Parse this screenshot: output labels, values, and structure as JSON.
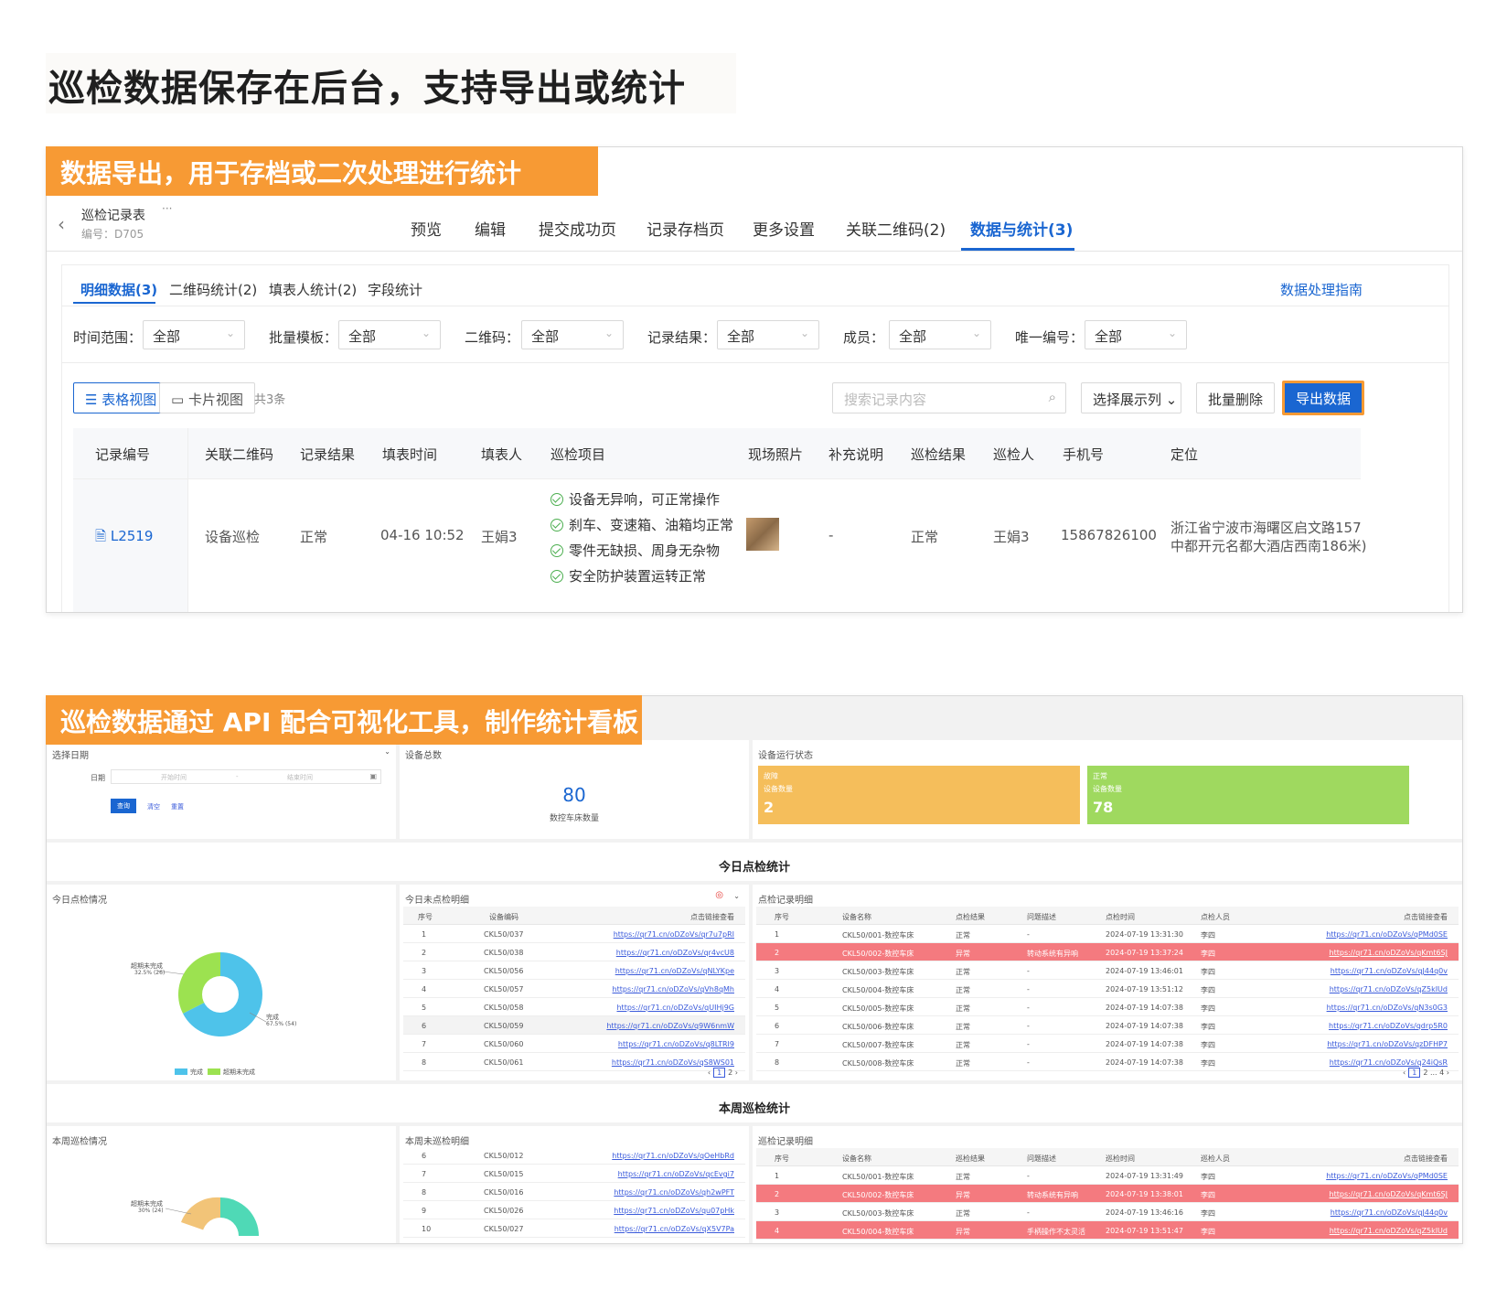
{
  "headline": "巡检数据保存在后台，支持导出或统计",
  "section1": {
    "banner": "数据导出，用于存档或二次处理进行统计",
    "form_title": "巡检记录表",
    "form_more": "···",
    "form_code": "编号：D705",
    "nav_tabs": [
      "预览",
      "编辑",
      "提交成功页",
      "记录存档页",
      "更多设置",
      "关联二维码(2)",
      "数据与统计(3)"
    ],
    "sub_tabs": [
      "明细数据(3)",
      "二维码统计(2)",
      "填表人统计(2)",
      "字段统计"
    ],
    "guide_link": "数据处理指南",
    "filters": [
      {
        "label": "时间范围：",
        "value": "全部"
      },
      {
        "label": "批量模板：",
        "value": "全部"
      },
      {
        "label": "二维码：",
        "value": "全部"
      },
      {
        "label": "记录结果：",
        "value": "全部"
      },
      {
        "label": "成员：",
        "value": "全部"
      },
      {
        "label": "唯一编号：",
        "value": "全部"
      }
    ],
    "view_table": "表格视图",
    "view_card": "卡片视图",
    "total": "共3条",
    "search_placeholder": "搜索记录内容",
    "choose_columns": "选择展示列",
    "batch_delete": "批量删除",
    "export": "导出数据",
    "columns": [
      "记录编号",
      "关联二维码",
      "记录结果",
      "填表时间",
      "填表人",
      "巡检项目",
      "现场照片",
      "补充说明",
      "巡检结果",
      "巡检人",
      "手机号",
      "定位"
    ],
    "row": {
      "id": "L2519",
      "qrcode": "设备巡检",
      "result": "正常",
      "time": "04-16 10:52",
      "filler": "王娟3",
      "items": [
        "设备无异响，可正常操作",
        "刹车、变速箱、油箱均正常",
        "零件无缺损、周身无杂物",
        "安全防护装置运转正常"
      ],
      "note": "-",
      "inspect_result": "正常",
      "inspector": "王娟3",
      "phone": "15867826100",
      "location_l1": "浙江省宁波市海曙区启文路157弄(",
      "location_l2": "中都开元名都大酒店西南186米)"
    },
    "accent": "#1a66d1"
  },
  "section2": {
    "banner": "巡检数据通过 API 配合可视化工具，制作统计看板",
    "date_panel": {
      "title": "选择日期",
      "label": "日期",
      "start": "开始时间",
      "sep": "-",
      "end": "结束时间",
      "query": "查询",
      "clear": "清空",
      "reset": "重置"
    },
    "total_panel": {
      "title": "设备总数",
      "value": "80",
      "caption": "数控车床数量"
    },
    "status_panel": {
      "title": "设备运行状态",
      "fault": {
        "label1": "故障",
        "label2": "设备数量",
        "value": "2",
        "color": "#f5be5b"
      },
      "normal": {
        "label1": "正常",
        "label2": "设备数量",
        "value": "78",
        "color": "#9fd95f"
      }
    },
    "today_title": "今日点检统计",
    "today_pie": {
      "title": "今日点检情况",
      "slices": [
        {
          "name": "完成",
          "label": "完成",
          "pct": "67.5% (54)",
          "value": 54,
          "color": "#4ec3ea"
        },
        {
          "name": "超期未完成",
          "label": "超期未完成",
          "pct": "32.5% (26)",
          "value": 26,
          "color": "#9ce250"
        }
      ],
      "legend": [
        "完成",
        "超期未完成"
      ]
    },
    "today_undone": {
      "title": "今日未点检明细",
      "headers": [
        "序号",
        "设备编码",
        "点击链接查看"
      ],
      "rows": [
        [
          "1",
          "CKL50/037",
          "https://qr71.cn/oDZoVs/qr7u7pRI"
        ],
        [
          "2",
          "CKL50/038",
          "https://qr71.cn/oDZoVs/qr4vcU8"
        ],
        [
          "3",
          "CKL50/056",
          "https://qr71.cn/oDZoVs/qNLYKpe"
        ],
        [
          "4",
          "CKL50/057",
          "https://qr71.cn/oDZoVs/qVh8qMh"
        ],
        [
          "5",
          "CKL50/058",
          "https://qr71.cn/oDZoVs/qUIHj9G"
        ],
        [
          "6",
          "CKL50/059",
          "https://qr71.cn/oDZoVs/q9W6nmW"
        ],
        [
          "7",
          "CKL50/060",
          "https://qr71.cn/oDZoVs/q8LTRI9"
        ],
        [
          "8",
          "CKL50/061",
          "https://qr71.cn/oDZoVs/qS8WS01"
        ]
      ],
      "pages": [
        "1",
        "2"
      ]
    },
    "today_records": {
      "title": "点检记录明细",
      "headers": [
        "序号",
        "设备名称",
        "点检结果",
        "问题描述",
        "点检时间",
        "点检人员",
        "点击链接查看"
      ],
      "rows": [
        [
          "1",
          "CKL50/001-数控车床",
          "正常",
          "-",
          "2024-07-19 13:31:30",
          "李四",
          "https://qr71.cn/oDZoVs/qPMd0SE"
        ],
        [
          "2",
          "CKL50/002-数控车床",
          "异常",
          "转动系统有异响",
          "2024-07-19 13:37:24",
          "李四",
          "https://qr71.cn/oDZoVs/qKmt6SJ"
        ],
        [
          "3",
          "CKL50/003-数控车床",
          "正常",
          "-",
          "2024-07-19 13:46:01",
          "李四",
          "https://qr71.cn/oDZoVs/qJ44q0v"
        ],
        [
          "4",
          "CKL50/004-数控车床",
          "正常",
          "-",
          "2024-07-19 13:51:12",
          "李四",
          "https://qr71.cn/oDZoVs/qZ5kIUd"
        ],
        [
          "5",
          "CKL50/005-数控车床",
          "正常",
          "-",
          "2024-07-19 14:07:38",
          "李四",
          "https://qr71.cn/oDZoVs/qN3s0G3"
        ],
        [
          "6",
          "CKL50/006-数控车床",
          "正常",
          "-",
          "2024-07-19 14:07:38",
          "李四",
          "https://qr71.cn/oDZoVs/qdrp5R0"
        ],
        [
          "7",
          "CKL50/007-数控车床",
          "正常",
          "-",
          "2024-07-19 14:07:38",
          "李四",
          "https://qr71.cn/oDZoVs/qzDFHP7"
        ],
        [
          "8",
          "CKL50/008-数控车床",
          "正常",
          "-",
          "2024-07-19 14:07:38",
          "李四",
          "https://qr71.cn/oDZoVs/q24iQsR"
        ]
      ],
      "red_rows": [
        1
      ],
      "pages": [
        "1",
        "2",
        "...",
        "4"
      ]
    },
    "week_title": "本周巡检统计",
    "week_pie": {
      "title": "本周巡检情况",
      "label": "超期未完成",
      "pct": "30% (24)"
    },
    "week_undone": {
      "title": "本周未巡检明细",
      "rows": [
        [
          "6",
          "CKL50/012",
          "https://qr71.cn/oDZoVs/qOeHbRd"
        ],
        [
          "7",
          "CKL50/015",
          "https://qr71.cn/oDZoVs/qcEvgi7"
        ],
        [
          "8",
          "CKL50/016",
          "https://qr71.cn/oDZoVs/qh2wPFT"
        ],
        [
          "9",
          "CKL50/026",
          "https://qr71.cn/oDZoVs/qu07pHk"
        ],
        [
          "10",
          "CKL50/027",
          "https://qr71.cn/oDZoVs/qX5V7Pa"
        ]
      ]
    },
    "week_records": {
      "title": "巡检记录明细",
      "headers": [
        "序号",
        "设备名称",
        "巡检结果",
        "问题描述",
        "巡检时间",
        "巡检人员",
        "点击链接查看"
      ],
      "rows": [
        [
          "1",
          "CKL50/001-数控车床",
          "正常",
          "-",
          "2024-07-19 13:31:49",
          "李四",
          "https://qr71.cn/oDZoVs/qPMd0SE"
        ],
        [
          "2",
          "CKL50/002-数控车床",
          "异常",
          "转动系统有异响",
          "2024-07-19 13:38:01",
          "李四",
          "https://qr71.cn/oDZoVs/qKmt6SJ"
        ],
        [
          "3",
          "CKL50/003-数控车床",
          "正常",
          "-",
          "2024-07-19 13:46:16",
          "李四",
          "https://qr71.cn/oDZoVs/qJ44q0v"
        ],
        [
          "4",
          "CKL50/004-数控车床",
          "异常",
          "手柄操作不太灵活",
          "2024-07-19 13:51:47",
          "李四",
          "https://qr71.cn/oDZoVs/qZ5kIUd"
        ]
      ],
      "red_rows": [
        1,
        3
      ]
    }
  }
}
